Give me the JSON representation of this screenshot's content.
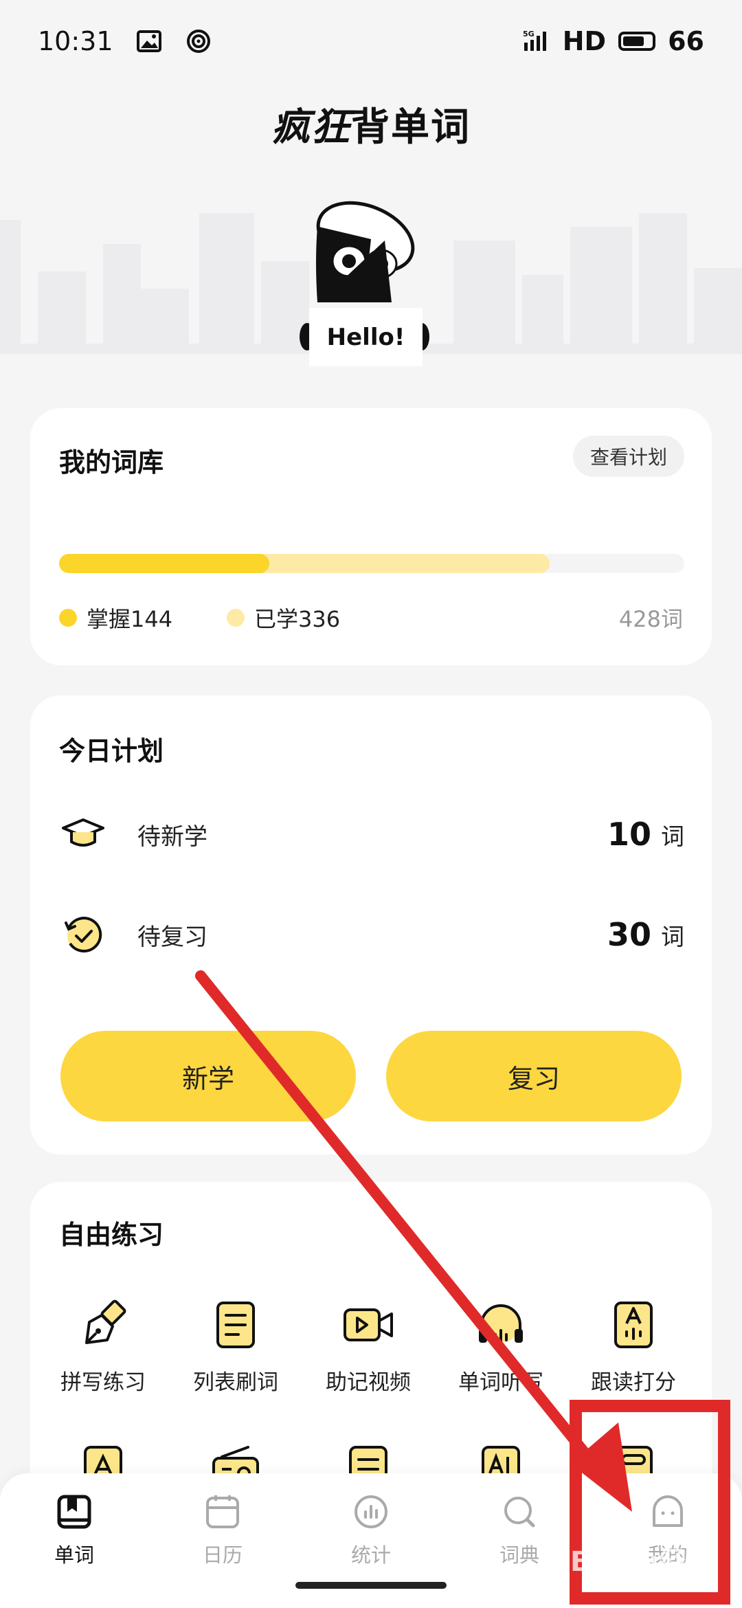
{
  "status_bar": {
    "time": "10:31",
    "network": "5G",
    "hd": "HD",
    "battery": "66"
  },
  "app": {
    "title_prefix": "疯狂",
    "title_suffix": "背单词"
  },
  "mascot": {
    "greeting": "Hello!"
  },
  "lexicon": {
    "title": "我的词库",
    "plan_button": "查看计划",
    "mastered_label": "掌握144",
    "learned_label": "已学336",
    "total_label": "428词",
    "mastered_fraction": 0.336,
    "learned_fraction": 0.785,
    "mastered_color": "#fcd52a",
    "learned_color": "#fdeaa5"
  },
  "today_plan": {
    "title": "今日计划",
    "rows": [
      {
        "icon": "graduation-cap-icon",
        "label": "待新学",
        "count": "10",
        "unit": "词"
      },
      {
        "icon": "review-clock-icon",
        "label": "待复习",
        "count": "30",
        "unit": "词"
      }
    ],
    "learn_button": "新学",
    "review_button": "复习",
    "accent_color": "#fdd73f"
  },
  "free_practice": {
    "title": "自由练习",
    "items": [
      {
        "icon": "pen-nib-icon",
        "label": "拼写练习"
      },
      {
        "icon": "list-doc-icon",
        "label": "列表刷词"
      },
      {
        "icon": "video-icon",
        "label": "助记视频"
      },
      {
        "icon": "headphones-icon",
        "label": "单词听写"
      },
      {
        "icon": "read-score-icon",
        "label": "跟读打分"
      }
    ],
    "second_row_icons": [
      "letter-card-icon",
      "radio-icon",
      "doc-lines-icon",
      "ai-card-icon",
      "card-icon"
    ]
  },
  "bottom_nav": {
    "items": [
      {
        "icon": "book-icon",
        "label": "单词",
        "active": true
      },
      {
        "icon": "calendar-icon",
        "label": "日历",
        "active": false
      },
      {
        "icon": "stats-icon",
        "label": "统计",
        "active": false
      },
      {
        "icon": "dictionary-search-icon",
        "label": "词典",
        "active": false
      },
      {
        "icon": "profile-face-icon",
        "label": "我的",
        "active": false
      }
    ]
  },
  "annotation": {
    "color": "#e02a2a",
    "watermark": "Baidu经验"
  }
}
